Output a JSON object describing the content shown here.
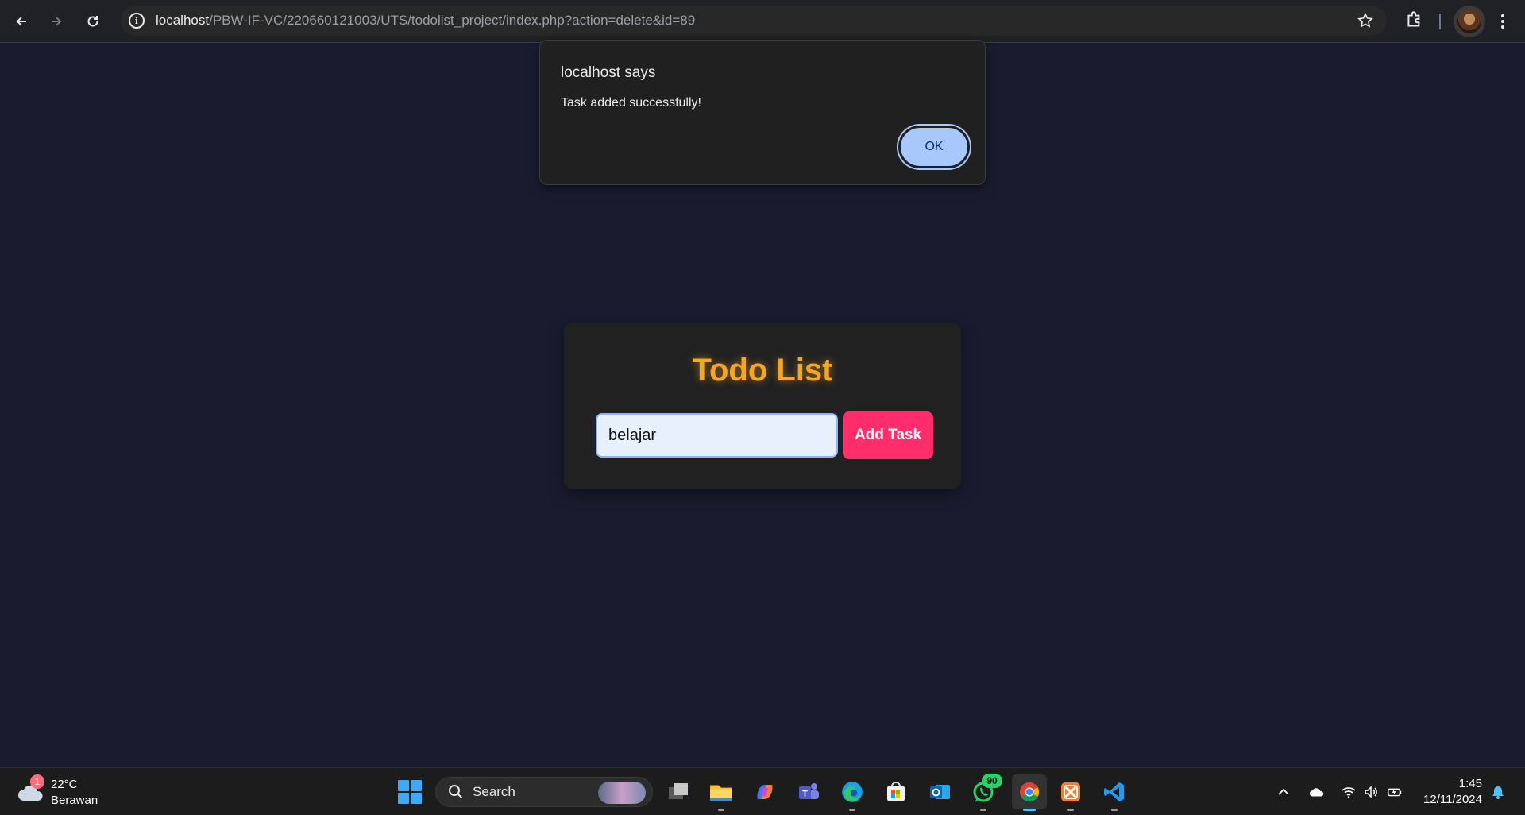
{
  "browser": {
    "url_host": "localhost",
    "url_path": "/PBW-IF-VC/220660121003/UTS/todolist_project/index.php?action=delete&id=89"
  },
  "dialog": {
    "title": "localhost says",
    "message": "Task added successfully!",
    "ok_label": "OK"
  },
  "app": {
    "title": "Todo List",
    "input_value": "belajar",
    "add_label": "Add Task",
    "accent_color": "#f5a623",
    "button_color": "#ff2d6b"
  },
  "taskbar": {
    "weather_badge": "1",
    "temperature": "22°C",
    "condition": "Berawan",
    "search_label": "Search",
    "whatsapp_badge": "90",
    "time": "1:45",
    "date": "12/11/2024",
    "apps": [
      "task-view-icon",
      "file-explorer-icon",
      "copilot-icon",
      "teams-icon",
      "edge-icon",
      "store-icon",
      "outlook-icon",
      "whatsapp-icon",
      "chrome-icon",
      "xampp-icon",
      "vscode-icon"
    ]
  }
}
